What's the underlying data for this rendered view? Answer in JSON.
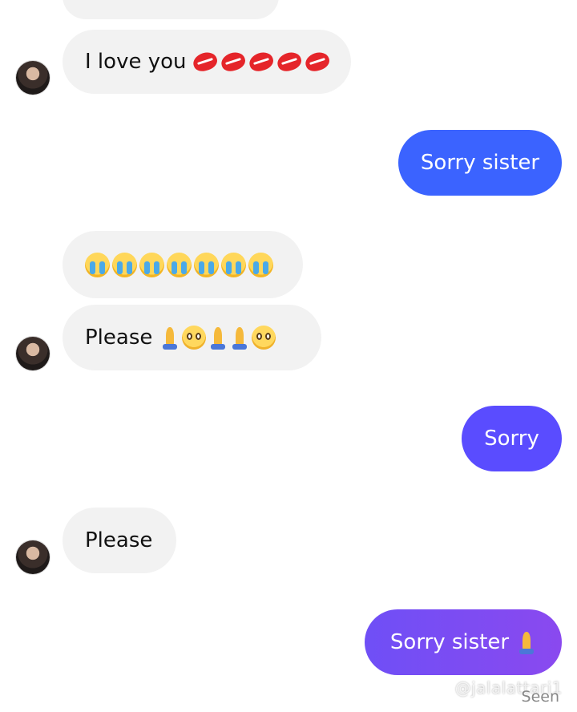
{
  "messages": [
    {
      "side": "incoming",
      "text": "I love you",
      "emoji": [
        "lips-emoji",
        "lips-emoji",
        "lips-emoji",
        "lips-emoji",
        "lips-emoji"
      ]
    },
    {
      "side": "outgoing",
      "text": "Sorry sister"
    },
    {
      "side": "incoming",
      "emoji": [
        "crying-face-emoji",
        "crying-face-emoji",
        "crying-face-emoji",
        "crying-face-emoji",
        "crying-face-emoji",
        "crying-face-emoji",
        "crying-face-emoji"
      ]
    },
    {
      "side": "incoming",
      "text": "Please",
      "emoji": [
        "praying-hands-emoji",
        "pleading-face-emoji",
        "praying-hands-emoji",
        "praying-hands-emoji",
        "pleading-face-emoji"
      ]
    },
    {
      "side": "outgoing",
      "text": "Sorry"
    },
    {
      "side": "incoming",
      "text": "Please"
    },
    {
      "side": "outgoing",
      "text": "Sorry sister",
      "emoji": [
        "praying-hands-emoji"
      ]
    }
  ],
  "status": {
    "seen_label": "Seen"
  },
  "watermark": {
    "text": "@jalalattari1"
  },
  "colors": {
    "incoming_bubble": "#f2f2f2",
    "outgoing_blue": "#3b63ff",
    "outgoing_indigo": "#5a4cff",
    "outgoing_purple": "#7b4bf3"
  }
}
